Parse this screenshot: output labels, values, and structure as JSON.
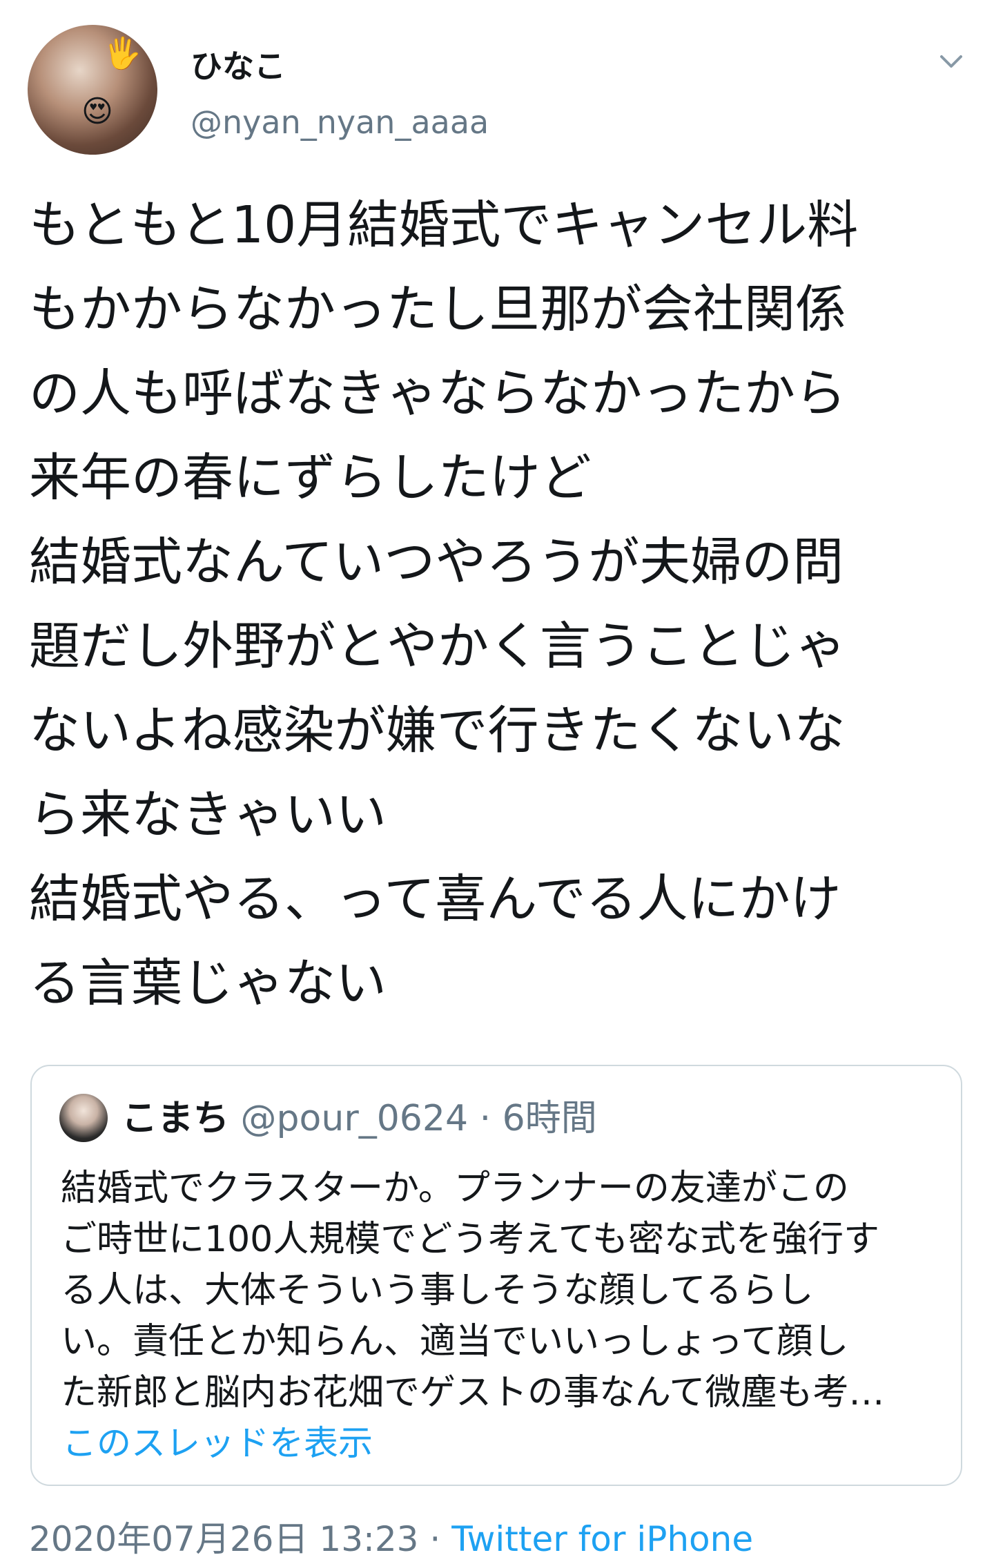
{
  "colors": {
    "text": "#14171a",
    "secondary": "#657786",
    "link": "#1da1f2",
    "border": "#cfd9de",
    "background": "#ffffff"
  },
  "author": {
    "display_name": "ひなこ",
    "handle": "@nyan_nyan_aaaa",
    "avatar_emojis": [
      "waving-hand",
      "heart-eyes-face"
    ]
  },
  "tweet": {
    "lines": [
      "もともと10月結婚式でキャンセル料",
      "もかからなかったし旦那が会社関係",
      "の人も呼ばなきゃならなかったから",
      "来年の春にずらしたけど",
      "結婚式なんていつやろうが夫婦の問",
      "題だし外野がとやかく言うことじゃ",
      "ないよね感染が嫌で行きたくないな",
      "ら来なきゃいい",
      "結婚式やる、って喜んでる人にかけ",
      "る言葉じゃない"
    ]
  },
  "quote": {
    "display_name": "こまち",
    "handle": "@pour_0624",
    "separator": "·",
    "time": "6時間",
    "lines": [
      "結婚式でクラスターか。プランナーの友達がこの",
      "ご時世に100人規模でどう考えても密な式を強行す",
      "る人は、大体そういう事しそうな顔してるらし",
      "い。責任とか知らん、適当でいいっしょって顔し",
      "た新郎と脳内お花畑でゲストの事なんて微塵も考…"
    ],
    "thread_link": "このスレッドを表示"
  },
  "footer": {
    "date": "2020年07月26日 13:23",
    "separator": "·",
    "source": "Twitter for iPhone"
  }
}
